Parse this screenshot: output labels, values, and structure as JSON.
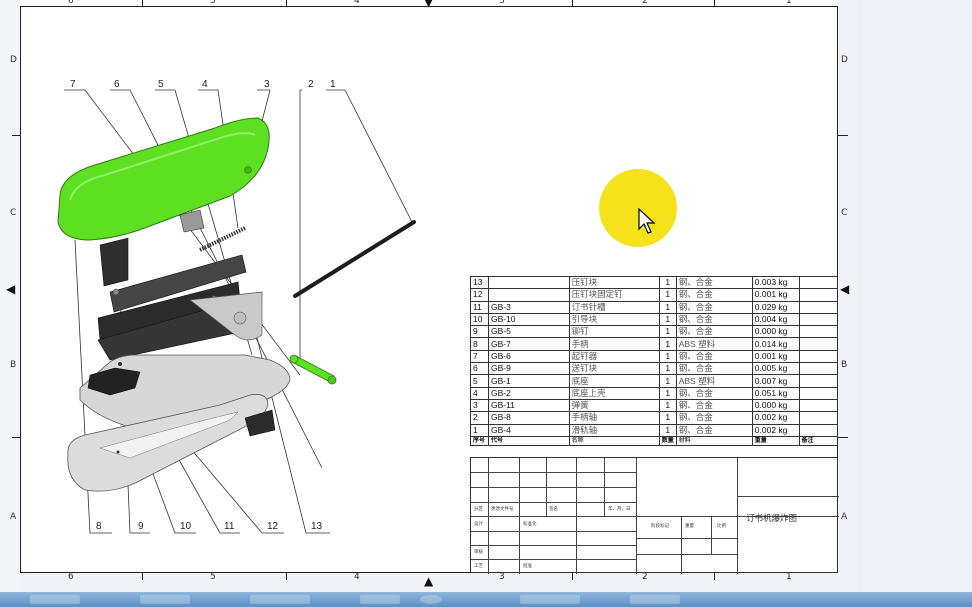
{
  "drawing": {
    "balloons_top": [
      "7",
      "6",
      "5",
      "4",
      "3",
      "2",
      "1"
    ],
    "balloons_bottom": [
      "8",
      "9",
      "10",
      "11",
      "12",
      "13"
    ]
  },
  "frame": {
    "columns_top": [
      "6",
      "5",
      "4",
      "3",
      "2",
      "1"
    ],
    "columns_bottom": [
      "6",
      "5",
      "4",
      "3",
      "2",
      "1"
    ],
    "rows_left": [
      "D",
      "C",
      "B",
      "A"
    ],
    "rows_right": [
      "D",
      "C",
      "B",
      "A"
    ]
  },
  "bom": {
    "rows": [
      {
        "no": "13",
        "code": "",
        "name": "压钉块",
        "qty": "1",
        "material": "钢、合金",
        "mass": "0.003 kg"
      },
      {
        "no": "12",
        "code": "",
        "name": "压钉块固定钉",
        "qty": "1",
        "material": "钢、合金",
        "mass": "0.001 kg"
      },
      {
        "no": "11",
        "code": "GB-3",
        "name": "订书针槽",
        "qty": "1",
        "material": "钢、合金",
        "mass": "0.029 kg"
      },
      {
        "no": "10",
        "code": "GB-10",
        "name": "引导块",
        "qty": "1",
        "material": "钢、合金",
        "mass": "0.004 kg"
      },
      {
        "no": "9",
        "code": "GB-5",
        "name": "铆钉",
        "qty": "1",
        "material": "钢、合金",
        "mass": "0.000 kg"
      },
      {
        "no": "8",
        "code": "GB-7",
        "name": "手柄",
        "qty": "1",
        "material": "ABS 塑料",
        "mass": "0.014 kg"
      },
      {
        "no": "7",
        "code": "GB-6",
        "name": "起钉器",
        "qty": "1",
        "material": "钢、合金",
        "mass": "0.001 kg"
      },
      {
        "no": "6",
        "code": "GB-9",
        "name": "送钉块",
        "qty": "1",
        "material": "钢、合金",
        "mass": "0.005 kg"
      },
      {
        "no": "5",
        "code": "GB-1",
        "name": "底座",
        "qty": "1",
        "material": "ABS 塑料",
        "mass": "0.007 kg"
      },
      {
        "no": "4",
        "code": "GB-2",
        "name": "底座上壳",
        "qty": "1",
        "material": "钢、合金",
        "mass": "0.051 kg"
      },
      {
        "no": "3",
        "code": "GB-11",
        "name": "弹簧",
        "qty": "1",
        "material": "钢、合金",
        "mass": "0.000 kg"
      },
      {
        "no": "2",
        "code": "GB-8",
        "name": "手柄轴",
        "qty": "1",
        "material": "钢、合金",
        "mass": "0.002 kg"
      },
      {
        "no": "1",
        "code": "GB-4",
        "name": "滑轨轴",
        "qty": "1",
        "material": "钢、合金",
        "mass": "0.002 kg"
      }
    ],
    "header": {
      "no": "序号",
      "code": "代号",
      "name": "名称",
      "qty": "数量",
      "material": "材料",
      "mass": "重量",
      "note": "备注"
    }
  },
  "title_block": {
    "drawing_title": "订书机爆炸图",
    "labels": {
      "designer": "设计",
      "checker": "审核",
      "process": "工艺",
      "approver": "批准",
      "standardization": "标准化",
      "date": "年、月、日",
      "stage_mark": "阶段标记",
      "weight": "重量",
      "scale": "比例",
      "sign": "签名",
      "zone": "分区",
      "change_doc": "更改文件号"
    }
  },
  "colors": {
    "handle_green": "#5ddf22",
    "cursor_highlight": "#f6e21a",
    "frame": "#222222"
  }
}
